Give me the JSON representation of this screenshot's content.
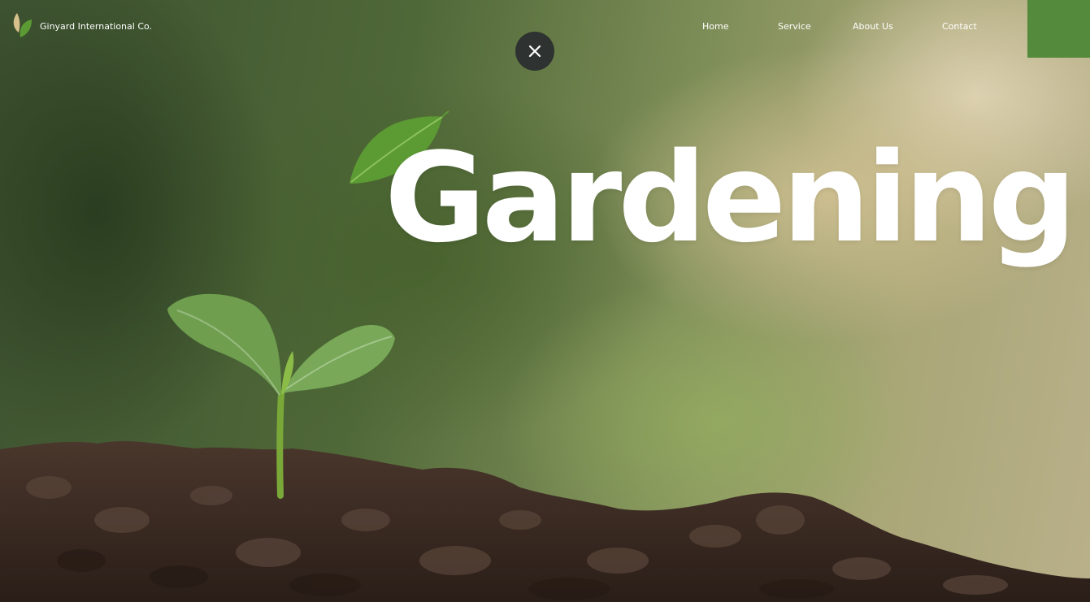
{
  "header": {
    "brand_name": "Ginyard International Co.",
    "logo_icon": "leaf-logo-icon"
  },
  "nav": {
    "items": [
      {
        "label": "Home"
      },
      {
        "label": "Service"
      },
      {
        "label": "About Us"
      },
      {
        "label": "Contact"
      }
    ]
  },
  "hero": {
    "headline": "Gardening"
  },
  "close_button": {
    "icon": "close-icon",
    "background": "#2e3230"
  },
  "colors": {
    "accent": "#548a3c",
    "text": "#ffffff",
    "soil": "#3a2a22"
  }
}
